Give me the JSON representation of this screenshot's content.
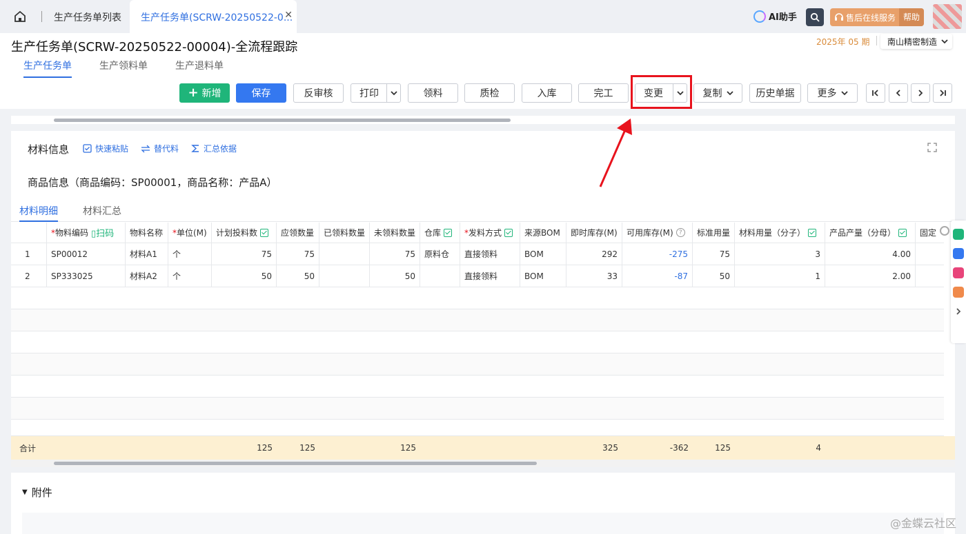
{
  "topbar": {
    "tabs": [
      {
        "label": "生产任务单列表"
      },
      {
        "label": "生产任务单(SCRW-20250522-0..."
      }
    ],
    "ai_label": "AI助手",
    "service_label": "售后在线服务",
    "help_label": "帮助"
  },
  "header": {
    "title": "生产任务单(SCRW-20250522-00004)-全流程跟踪",
    "period": "2025年 05 期",
    "company": "南山精密制造",
    "subtabs": [
      "生产任务单",
      "生产领料单",
      "生产退料单"
    ]
  },
  "toolbar": {
    "new": "新增",
    "save": "保存",
    "unaudit": "反审核",
    "print": "打印",
    "pick": "领料",
    "qc": "质检",
    "stockin": "入库",
    "finish": "完工",
    "change": "变更",
    "copy": "复制",
    "history": "历史单据",
    "more": "更多"
  },
  "materials": {
    "section_title": "材料信息",
    "links": [
      "快速粘贴",
      "替代料",
      "汇总依据"
    ],
    "product_info": "商品信息（商品编码：SP00001，商品名称：产品A）",
    "tabs": [
      "材料明细",
      "材料汇总"
    ],
    "scan_label": "扫码",
    "columns": [
      "物料编码",
      "物料名称",
      "单位(M)",
      "计划投料数",
      "应领数量",
      "已领料数量",
      "未领料数量",
      "仓库",
      "发料方式",
      "来源BOM",
      "即时库存(M)",
      "可用库存(M)",
      "标准用量",
      "材料用量（分子）",
      "产品产量（分母）",
      "固定"
    ],
    "rows": [
      {
        "idx": "1",
        "code": "SP00012",
        "name": "材料A1",
        "unit": "个",
        "plan": "75",
        "should": "75",
        "picked": "",
        "unpicked": "75",
        "warehouse": "原料仓",
        "method": "直接领料",
        "bom": "BOM",
        "stock": "292",
        "avail": "-275",
        "std": "75",
        "mol": "3",
        "den": "4.00"
      },
      {
        "idx": "2",
        "code": "SP333025",
        "name": "材料A2",
        "unit": "个",
        "plan": "50",
        "should": "50",
        "picked": "",
        "unpicked": "50",
        "warehouse": "",
        "method": "直接领料",
        "bom": "BOM",
        "stock": "33",
        "avail": "-87",
        "std": "50",
        "mol": "1",
        "den": "2.00"
      }
    ],
    "total": {
      "label": "合计",
      "plan": "125",
      "should": "125",
      "unpicked": "125",
      "stock": "325",
      "avail": "-362",
      "std": "125",
      "mol": "4"
    }
  },
  "attachments": {
    "title": "附件"
  },
  "watermark": "@金蝶云社区",
  "colors": {
    "accent": "#2f6fe0",
    "green": "#1fb57a",
    "highlight": "#e8131d",
    "arrow": "#e8131d"
  }
}
